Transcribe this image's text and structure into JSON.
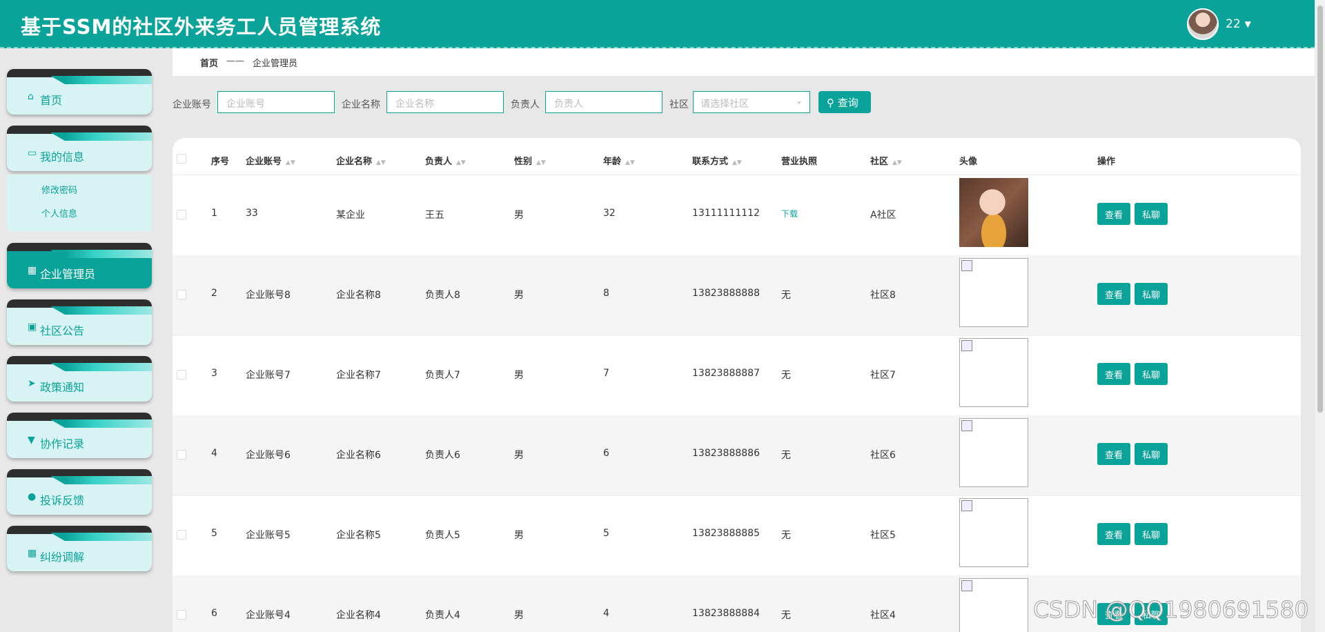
{
  "app": {
    "title": "基于SSM的社区外来务工人员管理系统"
  },
  "user": {
    "name": "22",
    "caret": "▼"
  },
  "sidebar": {
    "items": [
      {
        "label": "首页",
        "icon": "⌂"
      },
      {
        "label": "我的信息",
        "icon": "▭"
      },
      {
        "label": "企业管理员",
        "icon": "▦"
      },
      {
        "label": "社区公告",
        "icon": "▣"
      },
      {
        "label": "政策通知",
        "icon": "➤"
      },
      {
        "label": "协作记录",
        "icon": "▼"
      },
      {
        "label": "投诉反馈",
        "icon": "●"
      },
      {
        "label": "纠纷调解",
        "icon": "▦"
      }
    ],
    "submenu": [
      "修改密码",
      "个人信息"
    ]
  },
  "breadcrumb": {
    "home": "首页",
    "sep": "——",
    "current": "企业管理员"
  },
  "search": {
    "account_label": "企业账号",
    "account_placeholder": "企业账号",
    "name_label": "企业名称",
    "name_placeholder": "企业名称",
    "owner_label": "负责人",
    "owner_placeholder": "负责人",
    "community_label": "社区",
    "community_placeholder": "请选择社区",
    "query_label": "查询"
  },
  "table": {
    "headers": [
      "序号",
      "企业账号",
      "企业名称",
      "负责人",
      "性别",
      "年龄",
      "联系方式",
      "营业执照",
      "社区",
      "头像",
      "操作"
    ],
    "view_label": "查看",
    "chat_label": "私聊",
    "rows": [
      {
        "no": "1",
        "account": "33",
        "name": "某企业",
        "owner": "王五",
        "gender": "男",
        "age": "32",
        "phone": "13111111112",
        "license": "下载",
        "community": "A社区"
      },
      {
        "no": "2",
        "account": "企业账号8",
        "name": "企业名称8",
        "owner": "负责人8",
        "gender": "男",
        "age": "8",
        "phone": "13823888888",
        "license": "无",
        "community": "社区8"
      },
      {
        "no": "3",
        "account": "企业账号7",
        "name": "企业名称7",
        "owner": "负责人7",
        "gender": "男",
        "age": "7",
        "phone": "13823888887",
        "license": "无",
        "community": "社区7"
      },
      {
        "no": "4",
        "account": "企业账号6",
        "name": "企业名称6",
        "owner": "负责人6",
        "gender": "男",
        "age": "6",
        "phone": "13823888886",
        "license": "无",
        "community": "社区6"
      },
      {
        "no": "5",
        "account": "企业账号5",
        "name": "企业名称5",
        "owner": "负责人5",
        "gender": "男",
        "age": "5",
        "phone": "13823888885",
        "license": "无",
        "community": "社区5"
      },
      {
        "no": "6",
        "account": "企业账号4",
        "name": "企业名称4",
        "owner": "负责人4",
        "gender": "男",
        "age": "4",
        "phone": "13823888884",
        "license": "无",
        "community": "社区4"
      }
    ]
  },
  "watermark": "CSDN @QQ1980691580"
}
